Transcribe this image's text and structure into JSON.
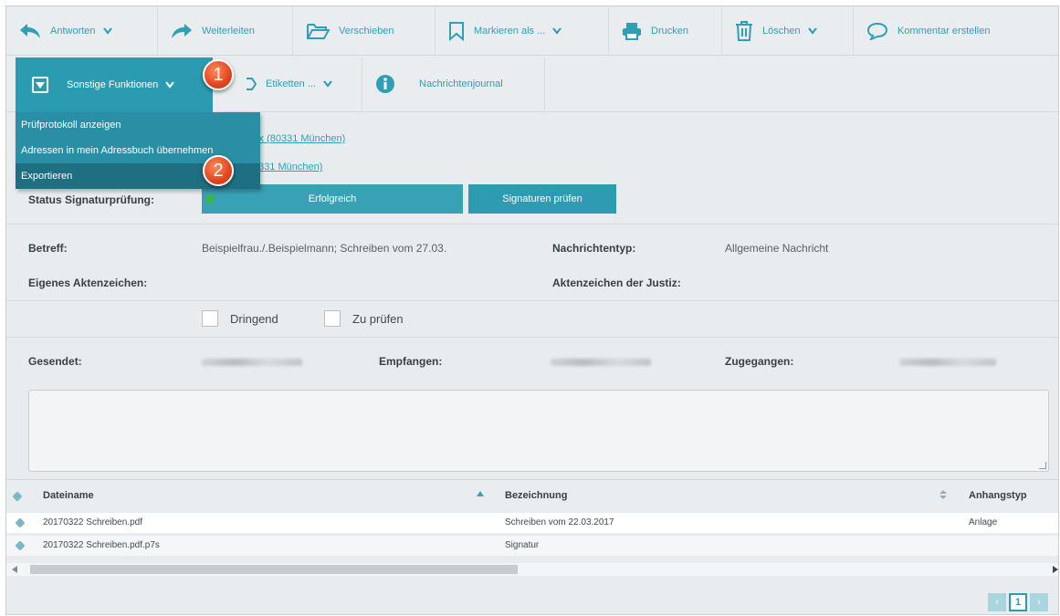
{
  "toolbar": {
    "reply": "Antworten",
    "forward": "Weiterleiten",
    "move": "Verschieben",
    "mark": "Markieren als ...",
    "print": "Drucken",
    "delete": "Löschen",
    "comment": "Kommentar erstellen"
  },
  "toolbar2": {
    "more": "Sonstige Funktionen",
    "labels": "Etiketten ...",
    "journal": "Nachrichtenjournal"
  },
  "menu": {
    "items": [
      "Prüfprotokoll anzeigen",
      "Adressen in mein Adressbuch übernehmen",
      "Exportieren"
    ]
  },
  "badges": [
    "1",
    "2"
  ],
  "message": {
    "sender_link": "n, Max (80331 München)",
    "recipient_link": "n (80331 München)",
    "sig_label": "Status Signaturprüfung:",
    "sig_status": "Erfolgreich",
    "sig_button": "Signaturen prüfen",
    "subject_label": "Betreff:",
    "subject_value": "Beispielfrau./.Beispielmann; Schreiben vom 27.03.",
    "type_label": "Nachrichtentyp:",
    "type_value": "Allgemeine Nachricht",
    "own_ref_label": "Eigenes Aktenzeichen:",
    "court_ref_label": "Aktenzeichen der Justiz:",
    "urgent_label": "Dringend",
    "review_label": "Zu prüfen",
    "sent_label": "Gesendet:",
    "received_label": "Empfangen:",
    "arrived_label": "Zugegangen:"
  },
  "table": {
    "headers": [
      "Dateiname",
      "Bezeichnung",
      "Anhangstyp"
    ],
    "rows": [
      [
        "20170322 Schreiben.pdf",
        "Schreiben vom 22.03.2017",
        "Anlage"
      ],
      [
        "20170322 Schreiben.pdf.p7s",
        "Signatur",
        ""
      ]
    ]
  },
  "pager": {
    "page": "1"
  },
  "colors": {
    "accent": "#2b9bb2",
    "badge": "#e2451d",
    "success": "#3bb54a"
  }
}
